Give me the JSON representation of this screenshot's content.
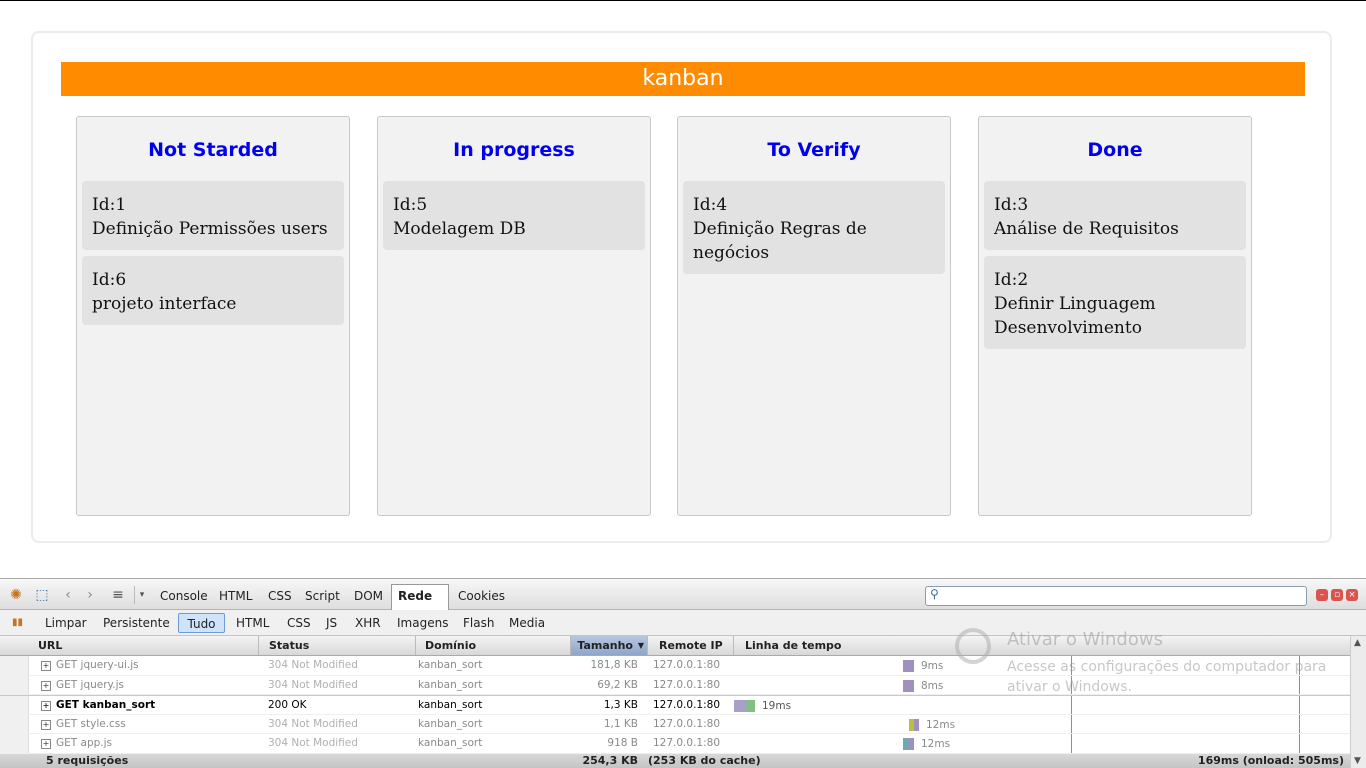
{
  "app": {
    "title": "kanban"
  },
  "columns": [
    {
      "title": "Not Starded",
      "cards": [
        {
          "id": "Id:1",
          "text": "Definição Permissões users"
        },
        {
          "id": "Id:6",
          "text": "projeto interface"
        }
      ]
    },
    {
      "title": "In progress",
      "cards": [
        {
          "id": "Id:5",
          "text": "Modelagem DB"
        }
      ]
    },
    {
      "title": "To Verify",
      "cards": [
        {
          "id": "Id:4",
          "text": "Definição Regras de negócios"
        }
      ]
    },
    {
      "title": "Done",
      "cards": [
        {
          "id": "Id:3",
          "text": "Análise de Requisitos"
        },
        {
          "id": "Id:2",
          "text": "Definir Linguagem Desenvolvimento"
        }
      ]
    }
  ],
  "firebug": {
    "tabs": [
      "Console",
      "HTML",
      "CSS",
      "Script",
      "DOM",
      "Rede",
      "Cookies"
    ],
    "active_tab": "Rede",
    "subtabs": [
      "Limpar",
      "Persistente",
      "Tudo",
      "HTML",
      "CSS",
      "JS",
      "XHR",
      "Imagens",
      "Flash",
      "Media"
    ],
    "active_subtab": "Tudo",
    "headers": {
      "url": "URL",
      "status": "Status",
      "domain": "Domínio",
      "size": "Tamanho",
      "ip": "Remote IP",
      "timeline": "Linha de tempo"
    },
    "requests": [
      {
        "url": "GET jquery-ui.js",
        "status": "304 Not Modified",
        "domain": "kanban_sort",
        "size": "181,8 KB",
        "ip": "127.0.0.1:80",
        "time": "9ms",
        "bar_color": "#a090c0",
        "bold": false
      },
      {
        "url": "GET jquery.js",
        "status": "304 Not Modified",
        "domain": "kanban_sort",
        "size": "69,2 KB",
        "ip": "127.0.0.1:80",
        "time": "8ms",
        "bar_color": "#a090c0",
        "bold": false
      },
      {
        "url": "GET kanban_sort",
        "status": "200 OK",
        "domain": "kanban_sort",
        "size": "1,3 KB",
        "ip": "127.0.0.1:80",
        "time": "19ms",
        "bar_color": "#a8a0c8",
        "bold": true
      },
      {
        "url": "GET style.css",
        "status": "304 Not Modified",
        "domain": "kanban_sort",
        "size": "1,1 KB",
        "ip": "127.0.0.1:80",
        "time": "12ms",
        "bar_color": "#b8c040",
        "bold": false
      },
      {
        "url": "GET app.js",
        "status": "304 Not Modified",
        "domain": "kanban_sort",
        "size": "918 B",
        "ip": "127.0.0.1:80",
        "time": "12ms",
        "bar_color": "#70a8b0",
        "bold": false
      }
    ],
    "footer": {
      "count": "5 requisições",
      "total": "254,3 KB",
      "cache": "(253 KB do cache)",
      "timing": "169ms (onload: 505ms)"
    }
  },
  "watermark": {
    "title": "Ativar o Windows",
    "text": "Acesse as configurações do computador para ativar o Windows."
  },
  "colors": {
    "banner": "#ff8c00",
    "column_title": "#0000ee",
    "card": "#e2e2e2"
  }
}
